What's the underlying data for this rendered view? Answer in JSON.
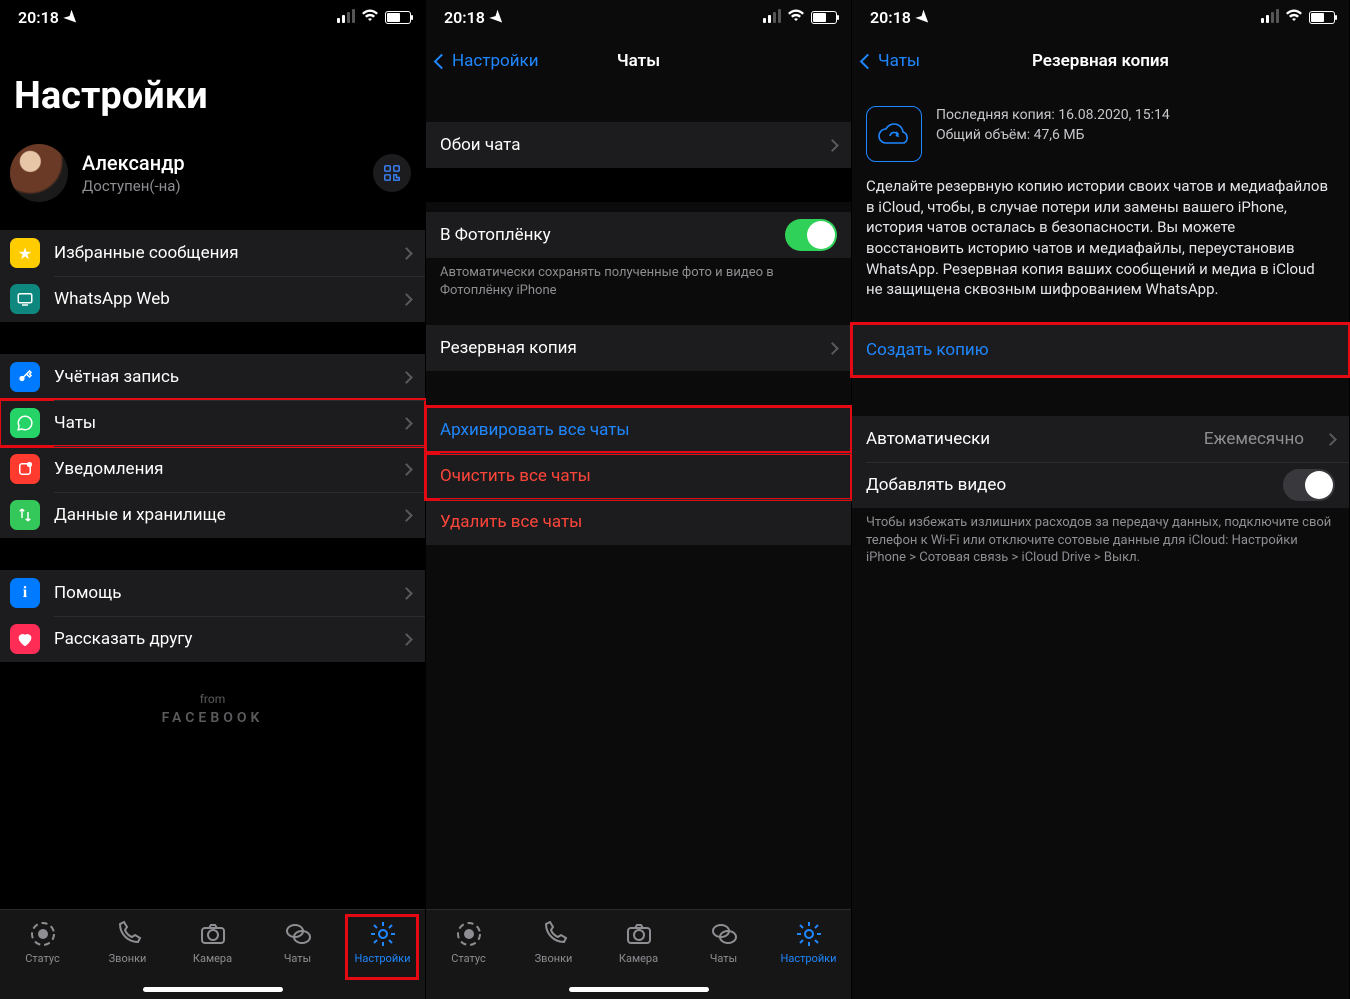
{
  "status": {
    "time": "20:18"
  },
  "screen1": {
    "title": "Настройки",
    "profile": {
      "name": "Александр",
      "status": "Доступен(-на)"
    },
    "rows": {
      "starred": "Избранные сообщения",
      "web": "WhatsApp Web",
      "account": "Учётная запись",
      "chats": "Чаты",
      "notif": "Уведомления",
      "data": "Данные и хранилище",
      "help": "Помощь",
      "tell": "Рассказать другу"
    },
    "brand": {
      "from": "from",
      "fb": "FACEBOOK"
    }
  },
  "tabs": {
    "status": "Статус",
    "calls": "Звонки",
    "camera": "Камера",
    "chats": "Чаты",
    "settings": "Настройки"
  },
  "screen2": {
    "back": "Настройки",
    "title": "Чаты",
    "wallpaper": "Обои чата",
    "cameraroll": "В Фотоплёнку",
    "cameraroll_note": "Автоматически сохранять полученные фото и видео в Фотоплёнку iPhone",
    "backup": "Резервная копия",
    "archive": "Архивировать все чаты",
    "clear": "Очистить все чаты",
    "delete": "Удалить все чаты"
  },
  "screen3": {
    "back": "Чаты",
    "title": "Резервная копия",
    "last": "Последняя копия: 16.08.2020, 15:14",
    "size": "Общий объём: 47,6 МБ",
    "desc": "Сделайте резервную копию истории своих чатов и медиафайлов в iCloud, чтобы, в случае потери или замены вашего iPhone, история чатов осталась в безопасности. Вы можете восстановить историю чатов и медиафайлы, переустановив WhatsApp. Резервная копия ваших сообщений и медиа в iCloud не защищена сквозным шифрованием WhatsApp.",
    "create": "Создать копию",
    "auto_label": "Автоматически",
    "auto_value": "Ежемесячно",
    "video": "Добавлять видео",
    "video_note": "Чтобы избежать излишних расходов за передачу данных, подключите свой телефон к Wi-Fi или отключите сотовые данные для iCloud: Настройки iPhone > Сотовая связь > iCloud Drive > Выкл."
  }
}
